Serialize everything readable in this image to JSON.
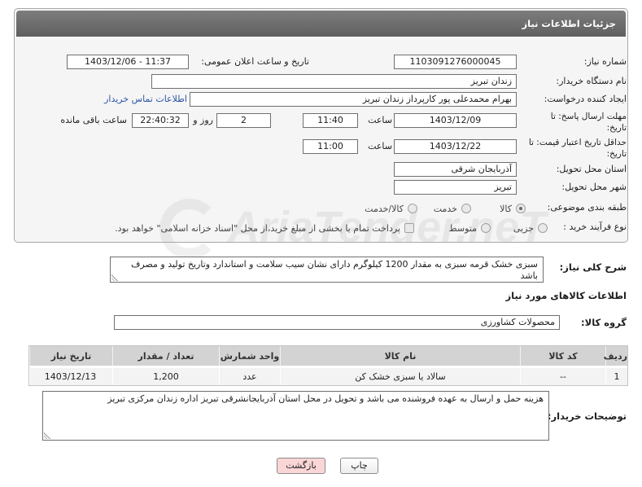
{
  "panel": {
    "title": "جزئیات اطلاعات نیاز"
  },
  "need_number": {
    "label": "شماره نیاز:",
    "value": "1103091276000045"
  },
  "announce": {
    "label": "تاریخ و ساعت اعلان عمومی:",
    "value": "1403/12/06 - 11:37"
  },
  "buyer_org": {
    "label": "نام دستگاه خریدار:",
    "value": "زندان تبریز"
  },
  "requester": {
    "label": "ایجاد کننده درخواست:",
    "value": "بهرام محمدعلی پور کارپرداز زندان تبریز",
    "contact_link": "اطلاعات تماس خریدار"
  },
  "response_deadline": {
    "label_line1": "مهلت ارسال پاسخ: تا",
    "label_line2": "تاریخ:",
    "date": "1403/12/09",
    "time_label": "ساعت",
    "time": "11:40",
    "days": "2",
    "days_label": "روز و",
    "remaining_time": "22:40:32",
    "remaining_label": "ساعت باقی مانده"
  },
  "price_validity": {
    "label_line1": "حداقل تاریخ اعتبار قیمت: تا",
    "label_line2": "تاریخ:",
    "date": "1403/12/22",
    "time_label": "ساعت",
    "time": "11:00"
  },
  "province": {
    "label": "استان محل تحویل:",
    "value": "آذربایجان شرقی"
  },
  "city": {
    "label": "شهر محل تحویل:",
    "value": "تبریز"
  },
  "category": {
    "label": "طبقه بندی موضوعی:",
    "options": [
      {
        "label": "کالا",
        "checked": true
      },
      {
        "label": "خدمت",
        "checked": false
      },
      {
        "label": "کالا/خدمت",
        "checked": false
      }
    ]
  },
  "purchase_process": {
    "label": "نوع فرآیند خرید :",
    "options": [
      {
        "label": "جزیی",
        "checked": false
      },
      {
        "label": "متوسط",
        "checked": false
      }
    ],
    "treasury_checkbox": {
      "label": "پرداخت تمام یا بخشی از مبلغ خرید،از محل \"اسناد خزانه اسلامی\" خواهد بود.",
      "checked": false
    }
  },
  "description": {
    "label": "شرح کلی نیاز:",
    "text": "سبزی خشک قرمه سبزی به مقدار 1200 کیلوگرم دارای نشان سیب سلامت و استاندارد وتاریخ تولید و مصرف باشد"
  },
  "goods_section_title": "اطلاعات کالاهای مورد نیاز",
  "goods_group": {
    "label": "گروه کالا:",
    "value": "محصولات کشاورزی"
  },
  "goods_table": {
    "headers": [
      "ردیف",
      "کد کالا",
      "نام کالا",
      "واحد شمارش",
      "تعداد / مقدار",
      "تاریخ نیاز"
    ],
    "rows": [
      {
        "row_number": "1",
        "code": "--",
        "name": "سالاد یا سبزی خشک کن",
        "unit": "عدد",
        "quantity": "1,200",
        "need_date": "1403/12/13"
      }
    ]
  },
  "buyer_notes": {
    "label": "توضیحات خریدار:",
    "text": "هزینه حمل و ارسال به عهده فروشنده می باشد و تحویل در محل استان آذربایجانشرقی تبریز اداره زندان مرکزی تبریز"
  },
  "buttons": {
    "print": "چاپ",
    "back": "بازگشت"
  },
  "colors": {
    "header_bg": "#5f5f5f",
    "link": "#2a56a8",
    "back_button_bg": "#fbd6d6",
    "table_header_bg": "#d3d3d3"
  },
  "watermark": "AriaTender.neT"
}
